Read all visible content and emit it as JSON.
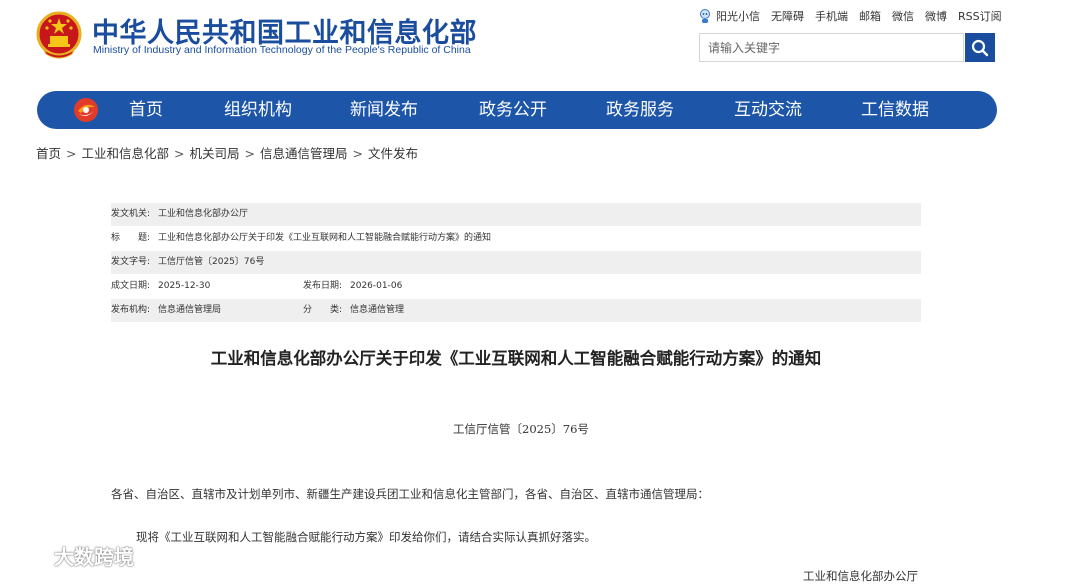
{
  "header": {
    "title_cn": "中华人民共和国工业和信息化部",
    "title_en": "Ministry of Industry and Information Technology of the People's Republic of China",
    "top_links": [
      "阳光小信",
      "无障碍",
      "手机端",
      "邮箱",
      "微信",
      "微博",
      "RSS订阅"
    ],
    "search_placeholder": "请输入关键字"
  },
  "nav": {
    "items": [
      "首页",
      "组织机构",
      "新闻发布",
      "政务公开",
      "政务服务",
      "互动交流",
      "工信数据"
    ]
  },
  "breadcrumb": [
    "首页",
    "工业和信息化部",
    "机关司局",
    "信息通信管理局",
    "文件发布"
  ],
  "meta": {
    "issuer_label": "发文机关:",
    "issuer": "工业和信息化部办公厅",
    "title_label": "标　　题:",
    "title": "工业和信息化部办公厅关于印发《工业互联网和人工智能融合赋能行动方案》的通知",
    "docno_label": "发文字号:",
    "docno": "工信厅信管〔2025〕76号",
    "created_label": "成文日期:",
    "created": "2025-12-30",
    "published_label": "发布日期:",
    "published": "2026-01-06",
    "org_label": "发布机构:",
    "org": "信息通信管理局",
    "category_label": "分　　类:",
    "category": "信息通信管理"
  },
  "document": {
    "title": "工业和信息化部办公厅关于印发《工业互联网和人工智能融合赋能行动方案》的通知",
    "number": "工信厅信管〔2025〕76号",
    "addressee": "各省、自治区、直辖市及计划单列市、新疆生产建设兵团工业和信息化主管部门，各省、自治区、直辖市通信管理局：",
    "body": "现将《工业互联网和人工智能融合赋能行动方案》印发给你们，请结合实际认真抓好落实。",
    "signature": "工业和信息化部办公厅"
  },
  "watermark": "大数跨境",
  "colors": {
    "brand_blue": "#1a4d9e",
    "nav_blue": "#1d56a8",
    "meta_shade": "#efefef"
  }
}
